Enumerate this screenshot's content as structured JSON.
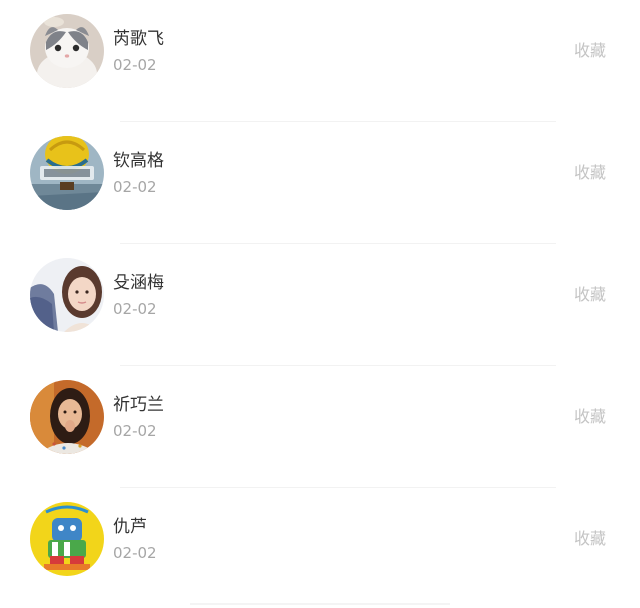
{
  "items": [
    {
      "name": "芮歌飞",
      "date": "02-02",
      "action": "收藏",
      "avatar": "avatar-cat-icon"
    },
    {
      "name": "钦高格",
      "date": "02-02",
      "action": "收藏",
      "avatar": "avatar-balloon-icon"
    },
    {
      "name": "殳涵梅",
      "date": "02-02",
      "action": "收藏",
      "avatar": "avatar-girl-portrait-icon"
    },
    {
      "name": "祈巧兰",
      "date": "02-02",
      "action": "收藏",
      "avatar": "avatar-woman-portrait-icon"
    },
    {
      "name": "仇芦",
      "date": "02-02",
      "action": "收藏",
      "avatar": "avatar-cartoon-icon"
    }
  ]
}
